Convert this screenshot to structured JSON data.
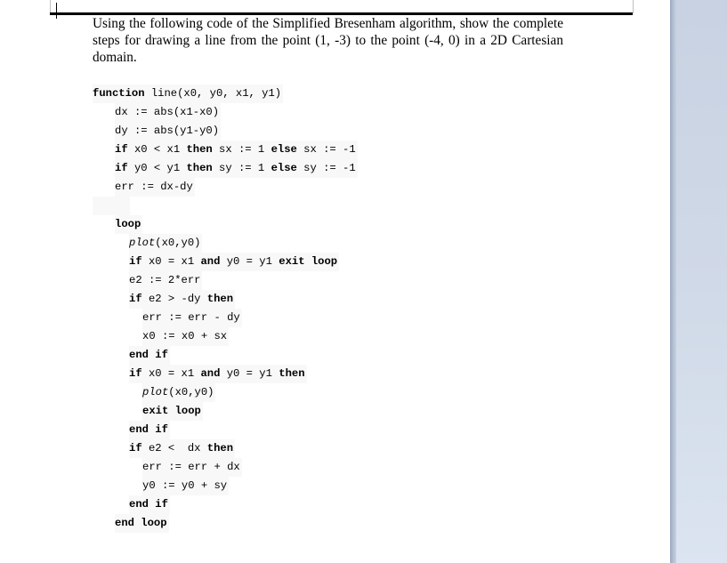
{
  "document": {
    "question": "Using the following code of the Simplified Bresenham algorithm, show the complete steps for drawing a line from the point (1, -3) to the point (-4, 0) in a 2D Cartesian domain.",
    "code_lines": [
      {
        "indent": 0,
        "tokens": [
          {
            "t": "function",
            "s": "b"
          },
          {
            "t": " line(x0, y0, x1, y1)"
          }
        ]
      },
      {
        "indent": 1,
        "tokens": [
          {
            "t": "dx := abs(x1-x0)"
          }
        ]
      },
      {
        "indent": 1,
        "tokens": [
          {
            "t": "dy := abs(y1-y0)"
          }
        ]
      },
      {
        "indent": 1,
        "tokens": [
          {
            "t": "if",
            "s": "b"
          },
          {
            "t": " x0 < x1 "
          },
          {
            "t": "then",
            "s": "b"
          },
          {
            "t": " sx := 1 "
          },
          {
            "t": "else",
            "s": "b"
          },
          {
            "t": " sx := -1"
          }
        ]
      },
      {
        "indent": 1,
        "tokens": [
          {
            "t": "if",
            "s": "b"
          },
          {
            "t": " y0 < y1 "
          },
          {
            "t": "then",
            "s": "b"
          },
          {
            "t": " sy := 1 "
          },
          {
            "t": "else",
            "s": "b"
          },
          {
            "t": " sy := -1"
          }
        ]
      },
      {
        "indent": 1,
        "tokens": [
          {
            "t": "err := dx-dy"
          }
        ]
      },
      {
        "indent": 0,
        "tokens": [
          {
            "t": ""
          }
        ]
      },
      {
        "indent": 1,
        "tokens": [
          {
            "t": "loop",
            "s": "b"
          }
        ]
      },
      {
        "indent": 2,
        "tokens": [
          {
            "t": "plot",
            "s": "i"
          },
          {
            "t": "(x0,y0)"
          }
        ]
      },
      {
        "indent": 2,
        "tokens": [
          {
            "t": "if",
            "s": "b"
          },
          {
            "t": " x0 = x1 "
          },
          {
            "t": "and",
            "s": "b"
          },
          {
            "t": " y0 = y1 "
          },
          {
            "t": "exit loop",
            "s": "b"
          }
        ]
      },
      {
        "indent": 2,
        "tokens": [
          {
            "t": "e2 := 2*err"
          }
        ]
      },
      {
        "indent": 2,
        "tokens": [
          {
            "t": "if",
            "s": "b"
          },
          {
            "t": " e2 > -dy "
          },
          {
            "t": "then",
            "s": "b"
          }
        ]
      },
      {
        "indent": 3,
        "tokens": [
          {
            "t": "err := err - dy"
          }
        ]
      },
      {
        "indent": 3,
        "tokens": [
          {
            "t": "x0 := x0 + sx"
          }
        ]
      },
      {
        "indent": 2,
        "tokens": [
          {
            "t": "end if",
            "s": "b"
          }
        ]
      },
      {
        "indent": 2,
        "tokens": [
          {
            "t": "if",
            "s": "b"
          },
          {
            "t": " x0 = x1 "
          },
          {
            "t": "and",
            "s": "b"
          },
          {
            "t": " y0 = y1 "
          },
          {
            "t": "then",
            "s": "b"
          }
        ]
      },
      {
        "indent": 3,
        "tokens": [
          {
            "t": "plot",
            "s": "i"
          },
          {
            "t": "(x0,y0)"
          }
        ]
      },
      {
        "indent": 3,
        "tokens": [
          {
            "t": "exit loop",
            "s": "b"
          }
        ]
      },
      {
        "indent": 2,
        "tokens": [
          {
            "t": "end if",
            "s": "b"
          }
        ]
      },
      {
        "indent": 2,
        "tokens": [
          {
            "t": "if",
            "s": "b"
          },
          {
            "t": " e2 <  dx "
          },
          {
            "t": "then",
            "s": "b"
          }
        ]
      },
      {
        "indent": 3,
        "tokens": [
          {
            "t": "err := err + dx"
          }
        ]
      },
      {
        "indent": 3,
        "tokens": [
          {
            "t": "y0 := y0 + sy"
          }
        ]
      },
      {
        "indent": 2,
        "tokens": [
          {
            "t": "end if",
            "s": "b"
          }
        ]
      },
      {
        "indent": 1,
        "tokens": [
          {
            "t": "end loop",
            "s": "b"
          }
        ]
      }
    ]
  }
}
